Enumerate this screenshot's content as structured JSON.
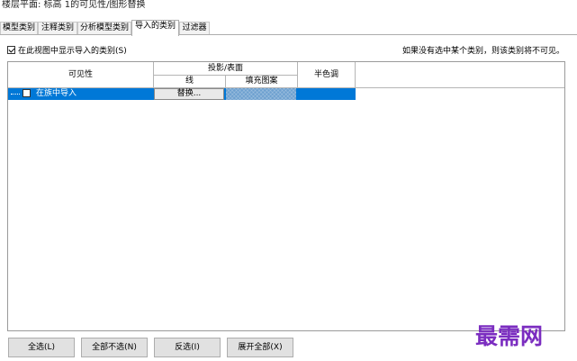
{
  "window": {
    "title": "楼层平面: 标高 1的可见性/图形替换"
  },
  "tabs": [
    {
      "label": "模型类别"
    },
    {
      "label": "注释类别"
    },
    {
      "label": "分析模型类别"
    },
    {
      "label": "导入的类别",
      "active": true
    },
    {
      "label": "过滤器"
    }
  ],
  "options": {
    "show_imported_label": "在此视图中显示导入的类别(S)",
    "show_imported_checked": true,
    "hint": "如果没有选中某个类别，则该类别将不可见。"
  },
  "grid": {
    "col_visibility": "可见性",
    "col_projection": "投影/表面",
    "col_lines": "线",
    "col_pattern": "填充图案",
    "col_halftone": "半色调",
    "rows": [
      {
        "label": "在族中导入",
        "checked": true,
        "lines_button": "替换...",
        "halftone": false
      }
    ]
  },
  "buttons": {
    "select_all": "全选(L)",
    "select_none": "全部不选(N)",
    "invert": "反选(I)",
    "expand_all": "展开全部(X)"
  },
  "watermark": "最需网",
  "colors": {
    "selection": "#0078d7",
    "watermark": "#7b2dc0"
  }
}
